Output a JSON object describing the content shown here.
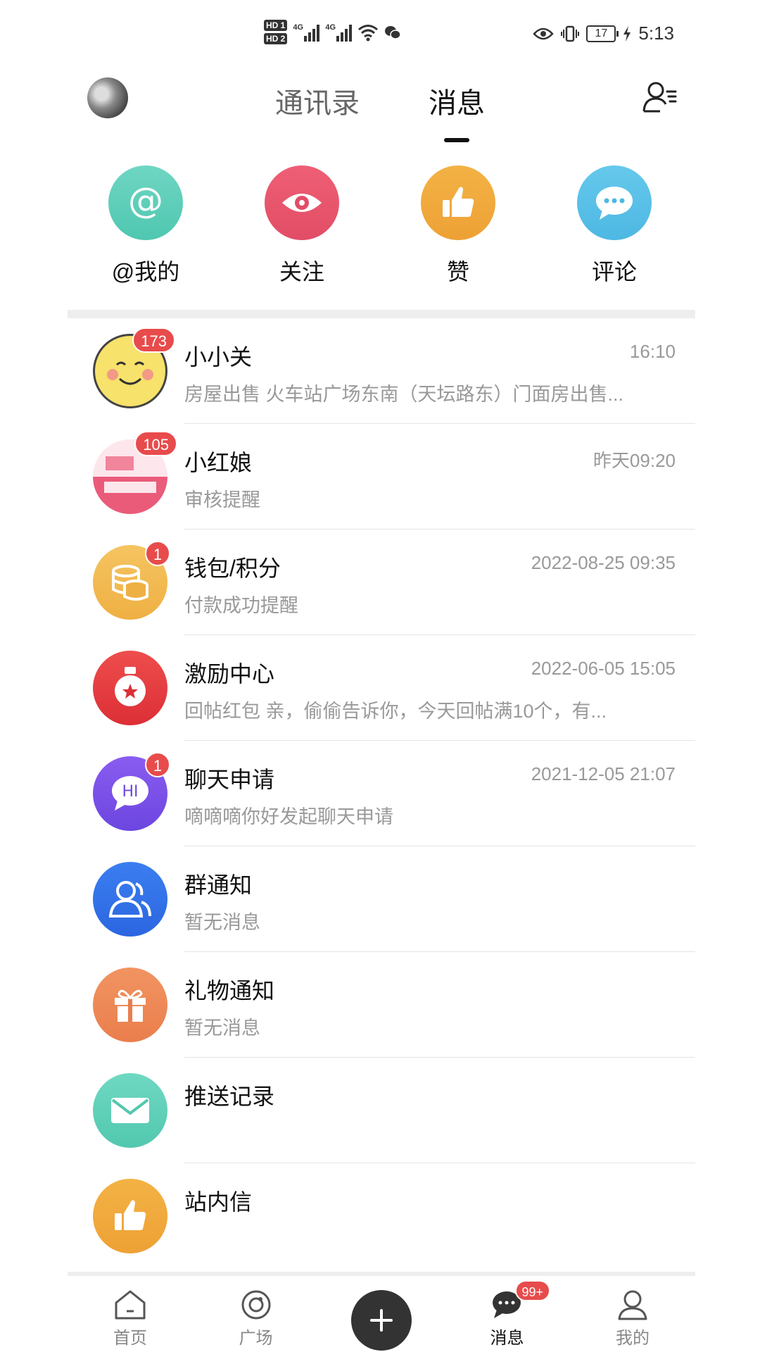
{
  "status_bar": {
    "hd1": "HD 1",
    "hd2": "HD 2",
    "net1": "4G",
    "net2": "4G",
    "battery": "17",
    "time": "5:13"
  },
  "header": {
    "tabs": [
      {
        "label": "通讯录",
        "active": false
      },
      {
        "label": "消息",
        "active": true
      }
    ]
  },
  "quick_actions": [
    {
      "label": "@我的",
      "icon": "at-icon",
      "color": "#5ccfb7"
    },
    {
      "label": "关注",
      "icon": "eye-icon",
      "color": "#e8566e"
    },
    {
      "label": "赞",
      "icon": "thumb-up-icon",
      "color": "#f0a83a"
    },
    {
      "label": "评论",
      "icon": "comment-icon",
      "color": "#5ac1e8"
    }
  ],
  "messages": [
    {
      "title": "小小关",
      "time": "16:10",
      "sub": "房屋出售 火车站广场东南（天坛路东）门面房出售...",
      "badge": "173",
      "icon": "smiley-avatar-icon"
    },
    {
      "title": "小红娘",
      "time": "昨天09:20",
      "sub": "审核提醒",
      "badge": "105",
      "icon": "matchmaker-avatar-icon"
    },
    {
      "title": "钱包/积分",
      "time": "2022-08-25 09:35",
      "sub": "付款成功提醒",
      "badge": "1",
      "icon": "coins-icon"
    },
    {
      "title": "激励中心",
      "time": "2022-06-05 15:05",
      "sub": "回帖红包 亲，偷偷告诉你，今天回帖满10个，有...",
      "badge": "",
      "icon": "medal-icon"
    },
    {
      "title": "聊天申请",
      "time": "2021-12-05 21:07",
      "sub": "嘀嘀嘀你好发起聊天申请",
      "badge": "1",
      "icon": "hi-chat-icon"
    },
    {
      "title": "群通知",
      "time": "",
      "sub": "暂无消息",
      "badge": "",
      "icon": "group-icon"
    },
    {
      "title": "礼物通知",
      "time": "",
      "sub": "暂无消息",
      "badge": "",
      "icon": "gift-icon"
    },
    {
      "title": "推送记录",
      "time": "",
      "sub": "",
      "badge": "",
      "icon": "mail-icon"
    },
    {
      "title": "站内信",
      "time": "",
      "sub": "",
      "badge": "",
      "icon": "thumb-up-icon"
    }
  ],
  "bottom_nav": [
    {
      "label": "首页",
      "icon": "home-icon",
      "active": false
    },
    {
      "label": "广场",
      "icon": "square-icon",
      "active": false
    },
    {
      "label": "",
      "icon": "plus-icon",
      "active": false
    },
    {
      "label": "消息",
      "icon": "message-icon",
      "active": true,
      "badge": "99+"
    },
    {
      "label": "我的",
      "icon": "profile-icon",
      "active": false
    }
  ]
}
